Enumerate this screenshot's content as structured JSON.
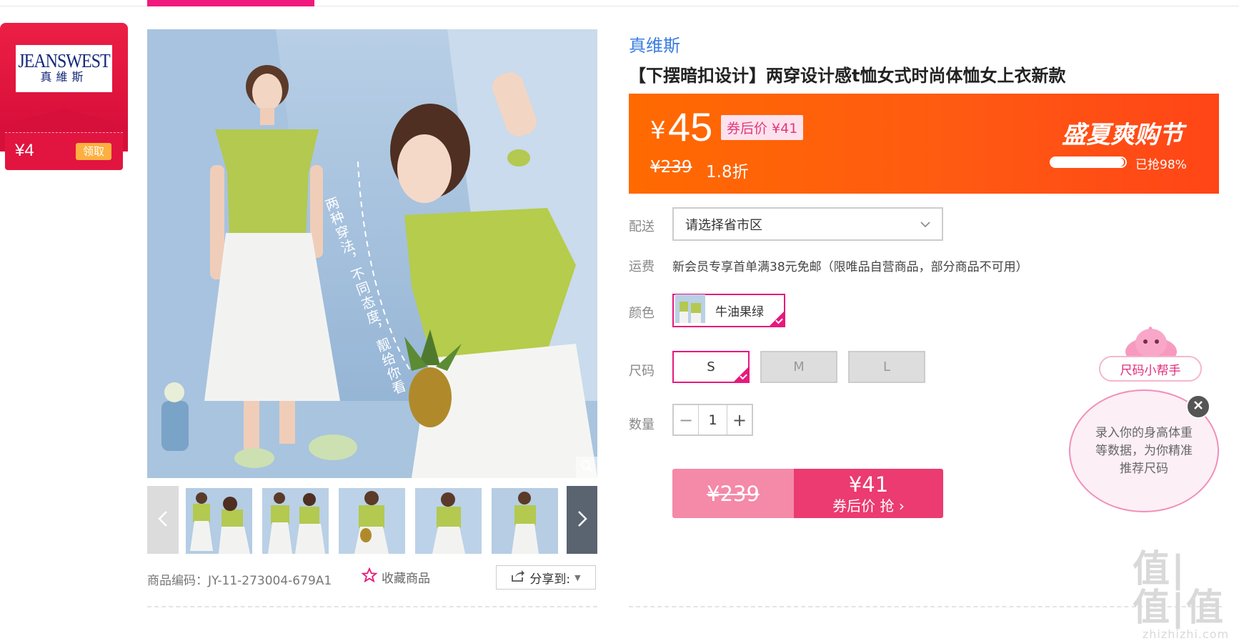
{
  "coupon": {
    "logo_text_en": "JEANSWEST",
    "logo_text_cn": "真維斯",
    "amount": "¥4",
    "claim_label": "领取"
  },
  "gallery": {
    "main_image_caption": "两种穿法，不同态度，靓给你看",
    "thumbnail_count": 5,
    "sku_label": "商品编码：JY-11-273004-679A1",
    "favorite_label": "收藏商品",
    "share_label": "分享到:"
  },
  "product": {
    "brand": "真维斯",
    "title": "【下摆暗扣设计】两穿设计感t恤女式时尚体恤女上衣新款"
  },
  "price": {
    "currency": "¥",
    "current": "45",
    "after_coupon": "券后价 ¥41",
    "original": "¥239",
    "discount": "1.8折",
    "event": "盛夏爽购节",
    "sold_percent": 98,
    "sold_text": "已抢98%"
  },
  "delivery": {
    "label": "配送",
    "placeholder": "请选择省市区"
  },
  "shipping": {
    "label": "运费",
    "text": "新会员专享首单满38元免邮（限唯品自营商品，部分商品不可用）"
  },
  "color": {
    "label": "颜色",
    "selected": "牛油果绿"
  },
  "size": {
    "label": "尺码",
    "options": [
      "S",
      "M",
      "L"
    ],
    "selected": "S"
  },
  "quantity": {
    "label": "数量",
    "value": "1",
    "minus": "−",
    "plus": "+"
  },
  "buy": {
    "original": "¥239",
    "price": "¥41",
    "action": "券后价 抢 ›"
  },
  "size_helper": {
    "tag": "尺码小帮手",
    "text": "录入你的身高体重等数据，为你精准推荐尺码"
  },
  "watermark": {
    "big": "值|值|值",
    "small": "zhizhizhi.com"
  },
  "colors": {
    "accent": "#f0197d",
    "price_banner": "#ff5a12",
    "brand_blue": "#3a7de0",
    "buy_dark": "#eb3b70",
    "buy_light": "#f489a8"
  }
}
